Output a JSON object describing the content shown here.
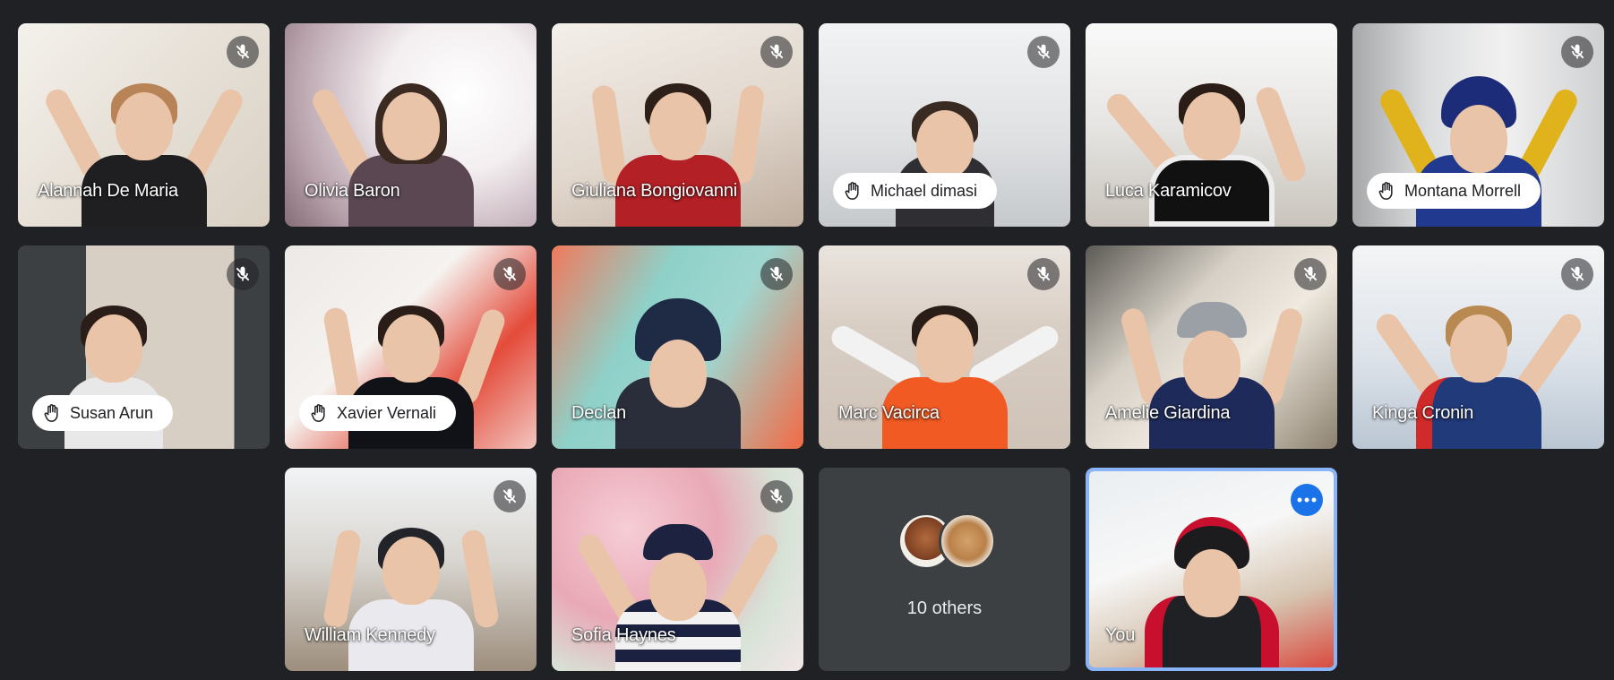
{
  "meeting": {
    "participants": [
      {
        "name": "Alannah De Maria",
        "label_style": "plain",
        "muted": true,
        "hand_raised": false
      },
      {
        "name": "Olivia Baron",
        "label_style": "plain",
        "muted": false,
        "hand_raised": false
      },
      {
        "name": "Giuliana Bongiovanni",
        "label_style": "plain",
        "muted": true,
        "hand_raised": false
      },
      {
        "name": "Michael dimasi",
        "label_style": "pill",
        "muted": true,
        "hand_raised": true
      },
      {
        "name": "Luca Karamicov",
        "label_style": "plain",
        "muted": false,
        "hand_raised": false
      },
      {
        "name": "Montana Morrell",
        "label_style": "pill",
        "muted": true,
        "hand_raised": true
      },
      {
        "name": "Susan Arun",
        "label_style": "pill",
        "muted": true,
        "hand_raised": true
      },
      {
        "name": "Xavier Vernali",
        "label_style": "pill",
        "muted": true,
        "hand_raised": true
      },
      {
        "name": "Declan",
        "label_style": "plain",
        "muted": true,
        "hand_raised": false
      },
      {
        "name": "Marc Vacirca",
        "label_style": "plain",
        "muted": true,
        "hand_raised": false
      },
      {
        "name": "Amelie Giardina",
        "label_style": "plain",
        "muted": true,
        "hand_raised": false
      },
      {
        "name": "Kinga Cronin",
        "label_style": "plain",
        "muted": true,
        "hand_raised": false
      },
      {
        "name": "William Kennedy",
        "label_style": "plain",
        "muted": true,
        "hand_raised": false
      },
      {
        "name": "Sofia Haynes",
        "label_style": "plain",
        "muted": true,
        "hand_raised": false
      }
    ],
    "others": {
      "label": "10 others"
    },
    "self": {
      "name": "You"
    }
  },
  "icons": {
    "muted": "mic-off-icon",
    "hand": "hand-raised-icon",
    "more": "more-options-icon",
    "avatar": "participant-avatar"
  },
  "colors": {
    "background": "#202124",
    "tile": "#3c4043",
    "self_border": "#8ab4f8",
    "more_button": "#1a73e8",
    "name_pill": "#ffffff",
    "name_text": "#ffffff"
  }
}
